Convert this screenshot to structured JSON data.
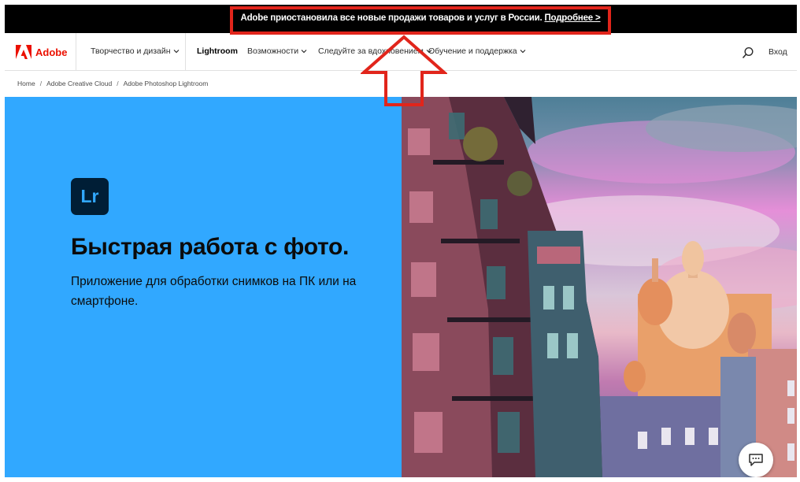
{
  "notice": {
    "text": "Adobe приостановила все новые продажи товаров и услуг в России.",
    "link": "Подробнее >"
  },
  "nav": {
    "logo": "Adobe",
    "items": [
      {
        "label": "Творчество и дизайн",
        "dropdown": true
      },
      {
        "label": "Lightroom",
        "dropdown": false,
        "active": true
      },
      {
        "label": "Возможности",
        "dropdown": true
      },
      {
        "label": "Следуйте за вдохновением",
        "dropdown": true
      },
      {
        "label": "Обучение и поддержка",
        "dropdown": true
      }
    ],
    "login": "Вход"
  },
  "breadcrumb": [
    "Home",
    "Adobe Creative Cloud",
    "Adobe Photoshop Lightroom"
  ],
  "hero": {
    "app_icon_text": "Lr",
    "title": "Быстрая работа с фото.",
    "subtitle": "Приложение для обработки снимков на ПК или на смартфоне."
  },
  "colors": {
    "adobe_red": "#eb1000",
    "hero_blue": "#31a8ff",
    "lr_icon_bg": "#001e36",
    "highlight_red": "#e1251b"
  },
  "icons": [
    "adobe-logo-icon",
    "chevron-down-icon",
    "search-icon",
    "chat-icon",
    "red-arrow-annotation"
  ]
}
